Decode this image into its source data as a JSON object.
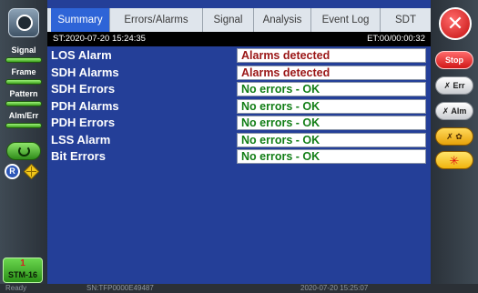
{
  "left_sidebar": {
    "items": [
      {
        "label": "Signal"
      },
      {
        "label": "Frame"
      },
      {
        "label": "Pattern"
      },
      {
        "label": "Alm/Err"
      }
    ],
    "r_badge": "R",
    "stm": {
      "number": "1",
      "label": "STM-16"
    }
  },
  "tabs": [
    {
      "label": "Summary",
      "active": true
    },
    {
      "label": "Errors/Alarms"
    },
    {
      "label": "Signal"
    },
    {
      "label": "Analysis"
    },
    {
      "label": "Event Log"
    },
    {
      "label": "SDT"
    }
  ],
  "status": {
    "st": "ST:2020-07-20 15:24:35",
    "et": "ET:00/00:00:32"
  },
  "results": [
    {
      "name": "LOS Alarm",
      "value": "Alarms detected",
      "state": "alarm"
    },
    {
      "name": "SDH Alarms",
      "value": "Alarms detected",
      "state": "alarm"
    },
    {
      "name": "SDH Errors",
      "value": "No errors - OK",
      "state": "ok"
    },
    {
      "name": "PDH Alarms",
      "value": "No errors - OK",
      "state": "ok"
    },
    {
      "name": "PDH Errors",
      "value": "No errors - OK",
      "state": "ok"
    },
    {
      "name": "LSS Alarm",
      "value": "No errors - OK",
      "state": "ok"
    },
    {
      "name": "Bit Errors",
      "value": "No errors - OK",
      "state": "ok"
    }
  ],
  "right_sidebar": {
    "close": "✕",
    "stop": "Stop",
    "err": "✗ Err",
    "alm": "✗ Alm",
    "tools": "✗ ✿",
    "laser": "✳"
  },
  "bottom": {
    "left": "Ready",
    "serial": "SN:TFP0000E49487",
    "datetime": "2020-07-20 15:25:07"
  },
  "colors": {
    "main_background": "#243f98",
    "active_tab": "#2e64d7",
    "alarm_text": "#9a1616",
    "ok_text": "#127e16",
    "led_green": "#5fd13a",
    "stop_red": "#d11818"
  },
  "icons": [
    "home-icon",
    "refresh-icon",
    "diamond-icon",
    "close-icon"
  ]
}
